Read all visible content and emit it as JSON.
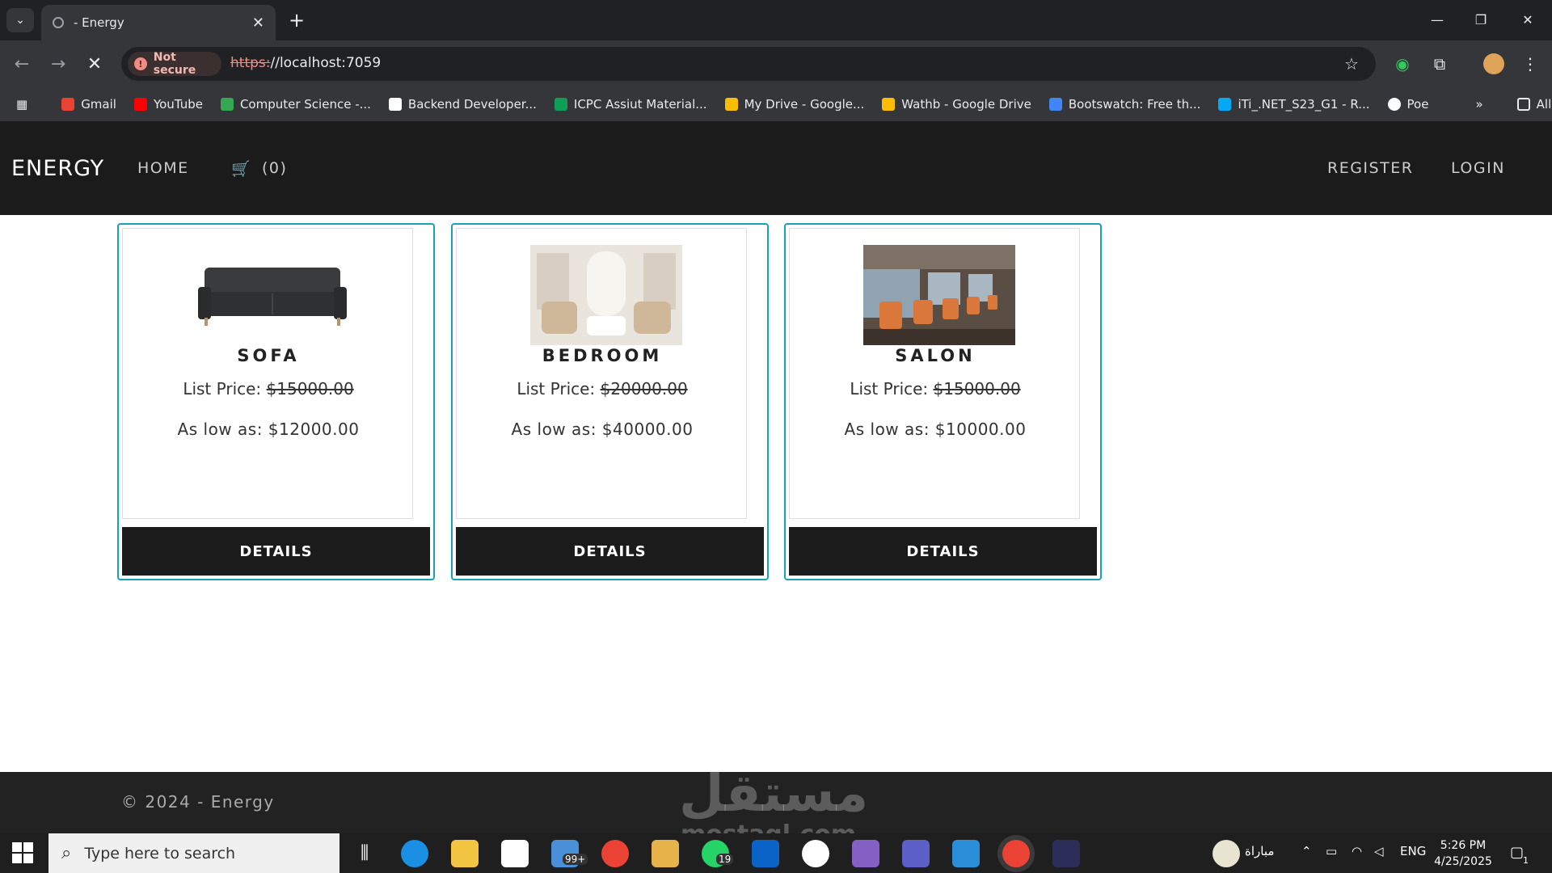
{
  "browser": {
    "tab_title": "- Energy",
    "tab_close": "✕",
    "new_tab": "+",
    "not_secure": "Not secure",
    "url_proto": "https:",
    "url_rest": "//localhost:7059",
    "bookmarks": [
      {
        "label": "Gmail",
        "color": "#ea4335"
      },
      {
        "label": "YouTube",
        "color": "#ff0000"
      },
      {
        "label": "Computer Science -...",
        "color": "#34a853"
      },
      {
        "label": "Backend Developer...",
        "color": "#ffffff"
      },
      {
        "label": "ICPC Assiut Material...",
        "color": "#0f9d58"
      },
      {
        "label": "My Drive - Google...",
        "color": "#fbbc04"
      },
      {
        "label": "Wathb - Google Drive",
        "color": "#fbbc04"
      },
      {
        "label": "Bootswatch: Free th...",
        "color": "#4285f4"
      },
      {
        "label": "iTi_.NET_S23_G1 - R...",
        "color": "#03a9f4"
      },
      {
        "label": "Poe",
        "color": "#ffffff"
      }
    ],
    "bookmarks_overflow": "»",
    "all_bookmarks": "All Bookmarks"
  },
  "site": {
    "brand": "ENERGY",
    "nav_home": "HOME",
    "cart_count": "(0)",
    "nav_register": "REGISTER",
    "nav_login": "LOGIN",
    "products": [
      {
        "name": "SOFA",
        "list_label": "List Price:",
        "list_price": "$15000.00",
        "low_label": "As low as:",
        "low_price": "$12000.00",
        "button": "DETAILS"
      },
      {
        "name": "BEDROOM",
        "list_label": "List Price:",
        "list_price": "$20000.00",
        "low_label": "As low as:",
        "low_price": "$40000.00",
        "button": "DETAILS"
      },
      {
        "name": "SALON",
        "list_label": "List Price:",
        "list_price": "$15000.00",
        "low_label": "As low as:",
        "low_price": "$10000.00",
        "button": "DETAILS"
      }
    ],
    "footer": "© 2024 - Energy"
  },
  "watermark": {
    "line1": "مستقل",
    "line2": "mostaql.com"
  },
  "taskbar": {
    "search_placeholder": "Type here to search",
    "mail_badge": "99+",
    "whatsapp_badge": "19",
    "weather_label": "مباراة",
    "lang": "ENG",
    "time": "5:26 PM",
    "date": "4/25/2025",
    "notif_count": "1"
  }
}
